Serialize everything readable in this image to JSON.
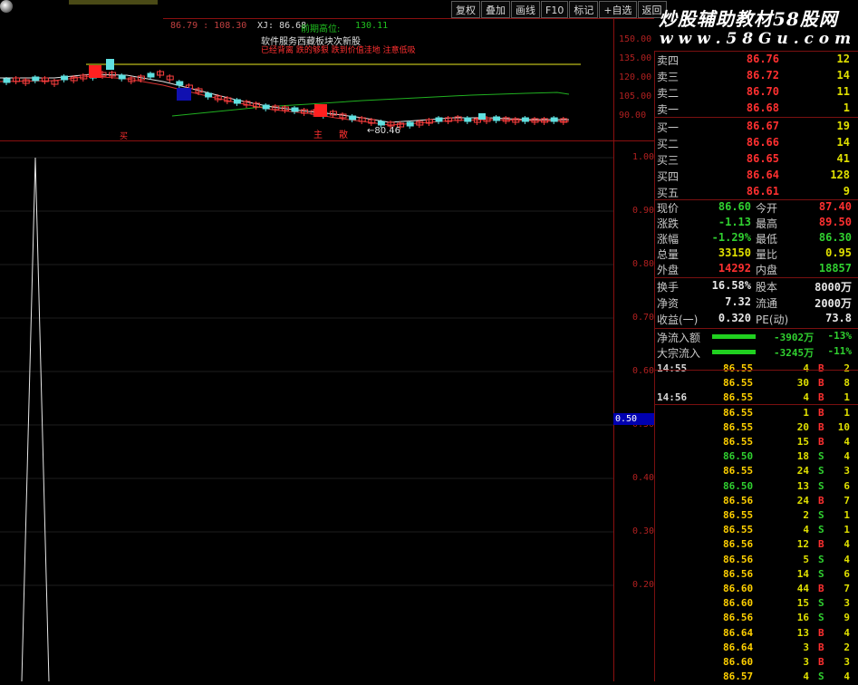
{
  "toolbar": {
    "buttons": [
      "复权",
      "叠加",
      "画线",
      "F10",
      "标记",
      "+自选",
      "返回"
    ]
  },
  "watermark": {
    "line1": "炒股辅助教材58股网",
    "line2": "w w w . 5 8 G u . c o m"
  },
  "kline_header": {
    "range_text": "86.79 : 108.30",
    "xj_text": "XJ: 86.68",
    "prev_high_label": "前期高位:",
    "prev_high_value": "130.11",
    "caption_line1": "软件服务西藏板块次新股",
    "caption_line2": "已经背离 跌的够狠 跌到价值洼地 注意低吸"
  },
  "kline_axis": [
    "150.00",
    "135.00",
    "120.00",
    "105.00",
    "90.00"
  ],
  "kline_labels": {
    "low_marker": "←80.46",
    "buy": "买",
    "sell": "卖",
    "signal1": "主",
    "signal2": "散"
  },
  "indicator_axis": [
    "1.00",
    "0.90",
    "0.80",
    "0.70",
    "0.60",
    "0.50",
    "0.40",
    "0.30",
    "0.20"
  ],
  "indicator_current": "0.50",
  "order_book": [
    {
      "label": "卖四",
      "price": "86.76",
      "vol": "12"
    },
    {
      "label": "卖三",
      "price": "86.72",
      "vol": "14"
    },
    {
      "label": "卖二",
      "price": "86.70",
      "vol": "11"
    },
    {
      "label": "卖一",
      "price": "86.68",
      "vol": "1"
    },
    {
      "label": "买一",
      "price": "86.67",
      "vol": "19"
    },
    {
      "label": "买二",
      "price": "86.66",
      "vol": "14"
    },
    {
      "label": "买三",
      "price": "86.65",
      "vol": "41"
    },
    {
      "label": "买四",
      "price": "86.64",
      "vol": "128"
    },
    {
      "label": "买五",
      "price": "86.61",
      "vol": "9"
    }
  ],
  "stats": [
    {
      "l1": "现价",
      "v1": "86.60",
      "c1": "green",
      "l2": "今开",
      "v2": "87.40",
      "c2": "red"
    },
    {
      "l1": "涨跌",
      "v1": "-1.13",
      "c1": "green",
      "l2": "最高",
      "v2": "89.50",
      "c2": "red"
    },
    {
      "l1": "涨幅",
      "v1": "-1.29%",
      "c1": "green",
      "l2": "最低",
      "v2": "86.30",
      "c2": "green"
    },
    {
      "l1": "总量",
      "v1": "33150",
      "c1": "yellow",
      "l2": "量比",
      "v2": "0.95",
      "c2": "yellow"
    },
    {
      "l1": "外盘",
      "v1": "14292",
      "c1": "red",
      "l2": "内盘",
      "v2": "18857",
      "c2": "green"
    },
    {
      "l1": "换手",
      "v1": "16.58%",
      "c1": "white",
      "l2": "股本",
      "v2": "8000万",
      "c2": "white"
    },
    {
      "l1": "净资",
      "v1": "7.32",
      "c1": "white",
      "l2": "流通",
      "v2": "2000万",
      "c2": "white"
    },
    {
      "l1": "收益(一)",
      "v1": "0.320",
      "c1": "white",
      "l2": "PE(动)",
      "v2": "73.8",
      "c2": "white"
    }
  ],
  "flows": [
    {
      "label": "净流入额",
      "value": "-3902万",
      "pct": "-13%"
    },
    {
      "label": "大宗流入",
      "value": "-3245万",
      "pct": "-11%"
    }
  ],
  "ticks": [
    {
      "time": "14:55",
      "price": "86.55",
      "vol": "4",
      "bs": "B",
      "count": "2"
    },
    {
      "time": "",
      "price": "86.55",
      "vol": "30",
      "bs": "B",
      "count": "8"
    },
    {
      "time": "14:56",
      "price": "86.55",
      "vol": "4",
      "bs": "B",
      "count": "1"
    },
    {
      "time": "",
      "price": "86.55",
      "vol": "1",
      "bs": "B",
      "count": "1"
    },
    {
      "time": "",
      "price": "86.55",
      "vol": "20",
      "bs": "B",
      "count": "10"
    },
    {
      "time": "",
      "price": "86.55",
      "vol": "15",
      "bs": "B",
      "count": "4"
    },
    {
      "time": "",
      "price": "86.50",
      "vol": "18",
      "bs": "S",
      "count": "4"
    },
    {
      "time": "",
      "price": "86.55",
      "vol": "24",
      "bs": "S",
      "count": "3"
    },
    {
      "time": "",
      "price": "86.50",
      "vol": "13",
      "bs": "S",
      "count": "6"
    },
    {
      "time": "",
      "price": "86.56",
      "vol": "24",
      "bs": "B",
      "count": "7"
    },
    {
      "time": "",
      "price": "86.55",
      "vol": "2",
      "bs": "S",
      "count": "1"
    },
    {
      "time": "",
      "price": "86.55",
      "vol": "4",
      "bs": "S",
      "count": "1"
    },
    {
      "time": "",
      "price": "86.56",
      "vol": "12",
      "bs": "B",
      "count": "4"
    },
    {
      "time": "",
      "price": "86.56",
      "vol": "5",
      "bs": "S",
      "count": "4"
    },
    {
      "time": "",
      "price": "86.56",
      "vol": "14",
      "bs": "S",
      "count": "6"
    },
    {
      "time": "",
      "price": "86.60",
      "vol": "44",
      "bs": "B",
      "count": "7"
    },
    {
      "time": "",
      "price": "86.60",
      "vol": "15",
      "bs": "S",
      "count": "3"
    },
    {
      "time": "",
      "price": "86.56",
      "vol": "16",
      "bs": "S",
      "count": "9"
    },
    {
      "time": "",
      "price": "86.64",
      "vol": "13",
      "bs": "B",
      "count": "4"
    },
    {
      "time": "",
      "price": "86.64",
      "vol": "3",
      "bs": "B",
      "count": "2"
    },
    {
      "time": "",
      "price": "86.60",
      "vol": "3",
      "bs": "B",
      "count": "3"
    },
    {
      "time": "",
      "price": "86.57",
      "vol": "4",
      "bs": "S",
      "count": "4"
    }
  ],
  "colors": {
    "up": "#ff3030",
    "down": "#30d030",
    "axis": "#8a1010",
    "price": "#ffd000"
  }
}
